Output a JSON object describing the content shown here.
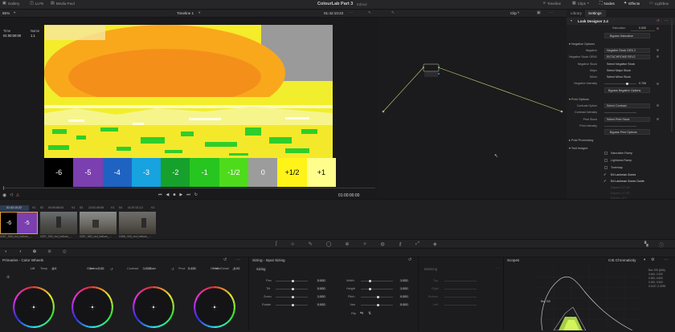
{
  "topbar": {
    "zoom_label": "85%",
    "gallery": "Gallery",
    "luts": "LUTs",
    "media_pool": "Media Pool",
    "project_title": "ColourLab Part 3",
    "project_status": "Edited",
    "timeline_label": "Timeline",
    "clips_label": "Clips",
    "nodes_label": "Nodes",
    "effects_label": "Effects",
    "lightbox_label": "Lightbox"
  },
  "viewer_bar": {
    "timeline_name": "Timeline 1",
    "timecode": "01:42:10:22",
    "clip_label": "Clip"
  },
  "clip_info": {
    "time_header": "Time",
    "name_header": "Name",
    "time_value": "01:00:00:00",
    "name_value": "1.1"
  },
  "chips": [
    {
      "label": "-6",
      "color": "#000000"
    },
    {
      "label": "-5",
      "color": "#7b3fb0"
    },
    {
      "label": "-4",
      "color": "#1f63c2"
    },
    {
      "label": "-3",
      "color": "#17a3e0"
    },
    {
      "label": "-2",
      "color": "#16a12d"
    },
    {
      "label": "-1",
      "color": "#27c51f"
    },
    {
      "label": "-1/2",
      "color": "#4edb1c"
    },
    {
      "label": "0",
      "color": "#9c9c9c"
    },
    {
      "label": "+1/2",
      "color": "#fff317"
    },
    {
      "label": "+1",
      "color": "#fffe8c"
    }
  ],
  "transport": {
    "timecode": "01:00:00:00"
  },
  "right_panel": {
    "tab_library": "Library",
    "tab_settings": "Settings",
    "plugin_name": "Look Designer 2.4",
    "saturation_label": "Saturation",
    "saturation_value": "0.000",
    "bypass_saturation": "Bypass Saturation",
    "negative_options": "Negative Options",
    "negative_label": "Negative",
    "negative_value": "Negative Stock GEN 2",
    "negative_stock_gen2_label": "Negative Stock GEN2",
    "negative_stock_gen2_value": "EKTACHROME REV2",
    "negative_stock_label": "Negative Stock",
    "negative_stock_value": "Select Negative Stock",
    "major_label": "Major",
    "major_value": "Select Major Stock",
    "minor_label": "Minor",
    "minor_value": "Select Minor Stock",
    "negative_intensity_label": "Negative Intensity",
    "negative_intensity_value": "0.706",
    "bypass_negative": "Bypass Negative Options",
    "print_options": "Print Options",
    "contrast_option_label": "Contrast Option",
    "contrast_option_value": "Select Contrast",
    "contrast_intensity_label": "Contrast Intensity",
    "print_stock_label": "Print Stock",
    "print_stock_value": "Select Print Stock",
    "print_intensity_label": "Print Intensity",
    "bypass_print": "Bypass Print Options",
    "post_processing": "Post Processing",
    "test_images": "Test Images",
    "saturation_ramp": "Saturation Ramp",
    "lightness_ramp": "Lightness Ramp",
    "tonemap": "Tonemap",
    "ed_lachman_zones": "Ed Lachman Zones",
    "ed_lachman_zones_guide": "Ed Lachman Zones Guide",
    "faded_1": "Export LUT 1D",
    "faded_2": "Export LUT 3D",
    "faded_3": "Bypass LUT"
  },
  "clip_bar": {
    "tc1": "01:42:10:22",
    "v1": "V1",
    "c2": "02",
    "tc2": "04:00:58:03",
    "v1b": "V1",
    "c3": "03",
    "tc3": "13:01:49:05",
    "v1c": "V1",
    "c4": "04",
    "tc4": "11:07:21:12",
    "v1d": "V1"
  },
  "thumbs": [
    {
      "name": "0257_008_red_helium_..."
    },
    {
      "name": "0257_030_red_helium_..."
    },
    {
      "name": "0257_060_red_helium_..."
    },
    {
      "name": "0358_018_red_helium_..."
    }
  ],
  "primaries": {
    "title": "Primaries - Color Wheels",
    "temp_label": "Temp",
    "temp_value": "0.0",
    "tint_label": "Tint",
    "tint_value": "0.00",
    "contrast_label": "Contrast",
    "contrast_value": "1.000",
    "pivot_label": "Pivot",
    "pivot_value": "0.435",
    "middetail_label": "Mid/Detail",
    "middetail_value": "0.00",
    "wheels": [
      "Lift",
      "Gamma",
      "Gain",
      "Offset"
    ]
  },
  "sizing": {
    "title": "Sizing - Input Sizing",
    "section": "Sizing",
    "pan_label": "Pan",
    "pan_value": "0.000",
    "tilt_label": "Tilt",
    "tilt_value": "0.000",
    "zoom_label": "Zoom",
    "zoom_value": "1.000",
    "rotate_label": "Rotate",
    "rotate_value": "0.000",
    "width_label": "Width",
    "width_value": "1.000",
    "height_label": "Height",
    "height_value": "1.000",
    "pitch_label": "Pitch",
    "pitch_value": "0.000",
    "yaw_label": "Yaw",
    "yaw_value": "0.000",
    "flip_label": "Flip"
  },
  "blanking": {
    "title": "Blanking",
    "top": "Top",
    "right": "Right",
    "bottom": "Bottom",
    "left": "Left"
  },
  "scopes": {
    "title": "Scopes",
    "mode": "CIE Chromaticity",
    "legend_1": "Rec.709 (D65)",
    "legend_2": "0.640, 0.330",
    "legend_3": "0.300, 0.600",
    "legend_4": "0.150, 0.060",
    "legend_5": "0.3127, 0.3290",
    "plot_label": "Rec.709"
  }
}
